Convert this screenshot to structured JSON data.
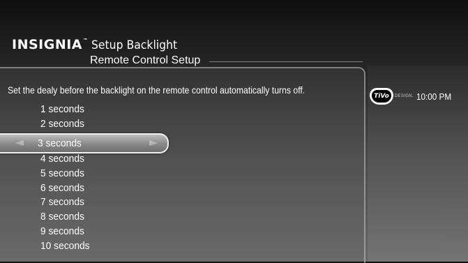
{
  "header": {
    "brand": "INSIGNIA",
    "brand_tm": "™",
    "title": "Setup Backlight",
    "subtitle": "Remote Control Setup"
  },
  "instruction": "Set the dealy before the backlight on the remote control automatically turns off.",
  "options": {
    "above": [
      "1 seconds",
      "2 seconds"
    ],
    "selected": "3 seconds",
    "below": [
      "4 seconds",
      "5 seconds",
      "6 seconds",
      "7 seconds",
      "8 seconds",
      "9 seconds",
      "10 seconds"
    ]
  },
  "status": {
    "logo": "TiVo",
    "design_label": "DESIGN.",
    "time": "10:00 PM"
  },
  "icons": {
    "left": "arrow-left-icon",
    "right": "arrow-right-icon"
  }
}
